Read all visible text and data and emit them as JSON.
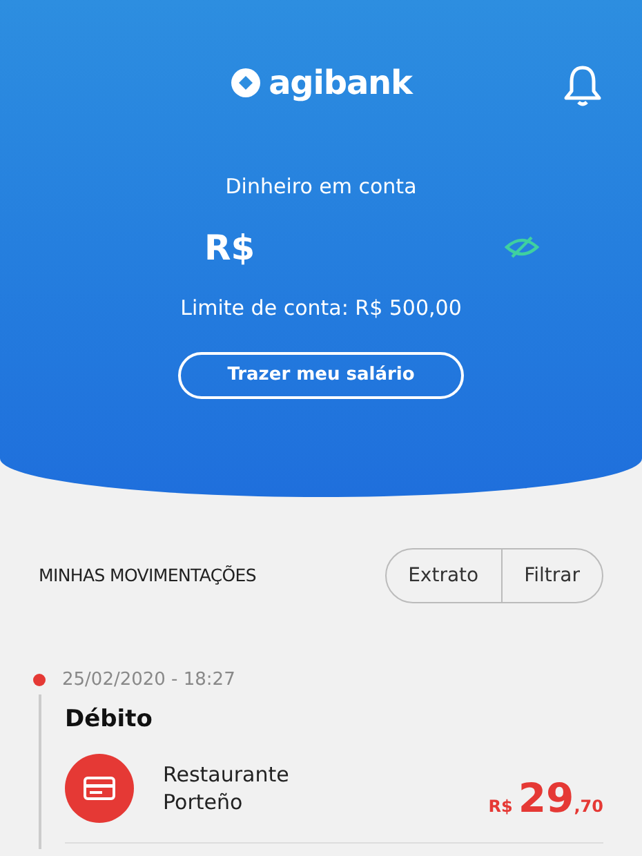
{
  "header": {
    "brand": "agibank",
    "balance_label": "Dinheiro em conta",
    "currency": "R$",
    "limit": "Limite de conta: R$ 500,00",
    "cta": "Trazer meu salário"
  },
  "movements": {
    "title": "MINHAS MOVIMENTAÇÕES",
    "actions": [
      "Extrato",
      "Filtrar"
    ],
    "entries": [
      {
        "datetime": "25/02/2020 - 18:27",
        "type": "Débito",
        "merchant": "Restaurante Porteño",
        "currency": "R$",
        "amount": "29",
        "cents": ",70"
      }
    ]
  }
}
